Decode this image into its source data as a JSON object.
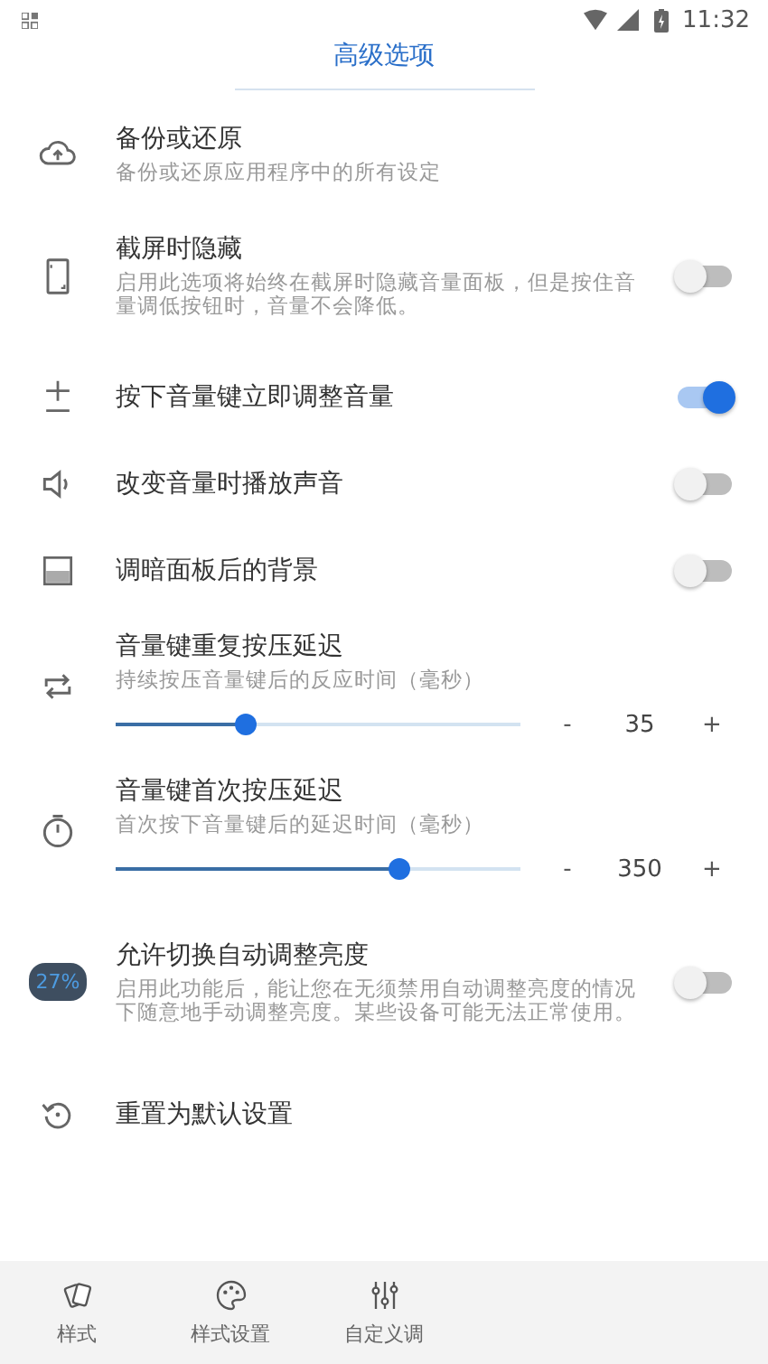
{
  "status_bar": {
    "time": "11:32"
  },
  "header": {
    "title": "高级选项"
  },
  "settings": [
    {
      "kind": "action",
      "title": "备份或还原",
      "subtitle": "备份或还原应用程序中的所有设定"
    },
    {
      "kind": "toggle",
      "title": "截屏时隐藏",
      "subtitle": "启用此选项将始终在截屏时隐藏音量面板，但是按住音量调低按钮时，音量不会降低。",
      "on": false
    },
    {
      "kind": "toggle",
      "title": "按下音量键立即调整音量",
      "on": true
    },
    {
      "kind": "toggle",
      "title": "改变音量时播放声音",
      "on": false
    },
    {
      "kind": "toggle",
      "title": "调暗面板后的背景",
      "on": false
    },
    {
      "kind": "slider",
      "title": "音量键重复按压延迟",
      "subtitle": "持续按压音量键后的反应时间（毫秒）",
      "level": 0.32,
      "minus": "-",
      "value": "35",
      "plus": "+"
    },
    {
      "kind": "slider",
      "title": "音量键首次按压延迟",
      "subtitle": "首次按下音量键后的延迟时间（毫秒）",
      "level": 0.7,
      "minus": "-",
      "value": "350",
      "plus": "+"
    },
    {
      "kind": "toggle",
      "icon_text": "27%",
      "title": "允许切换自动调整亮度",
      "subtitle": "启用此功能后，能让您在无须禁用自动调整亮度的情况下随意地手动调整亮度。某些设备可能无法正常使用。",
      "on": false
    },
    {
      "kind": "action",
      "title": "重置为默认设置"
    }
  ],
  "bottom_nav": [
    {
      "label": "样式",
      "selected": false
    },
    {
      "label": "样式设置",
      "selected": false
    },
    {
      "label": "自定义调",
      "selected": false
    }
  ]
}
